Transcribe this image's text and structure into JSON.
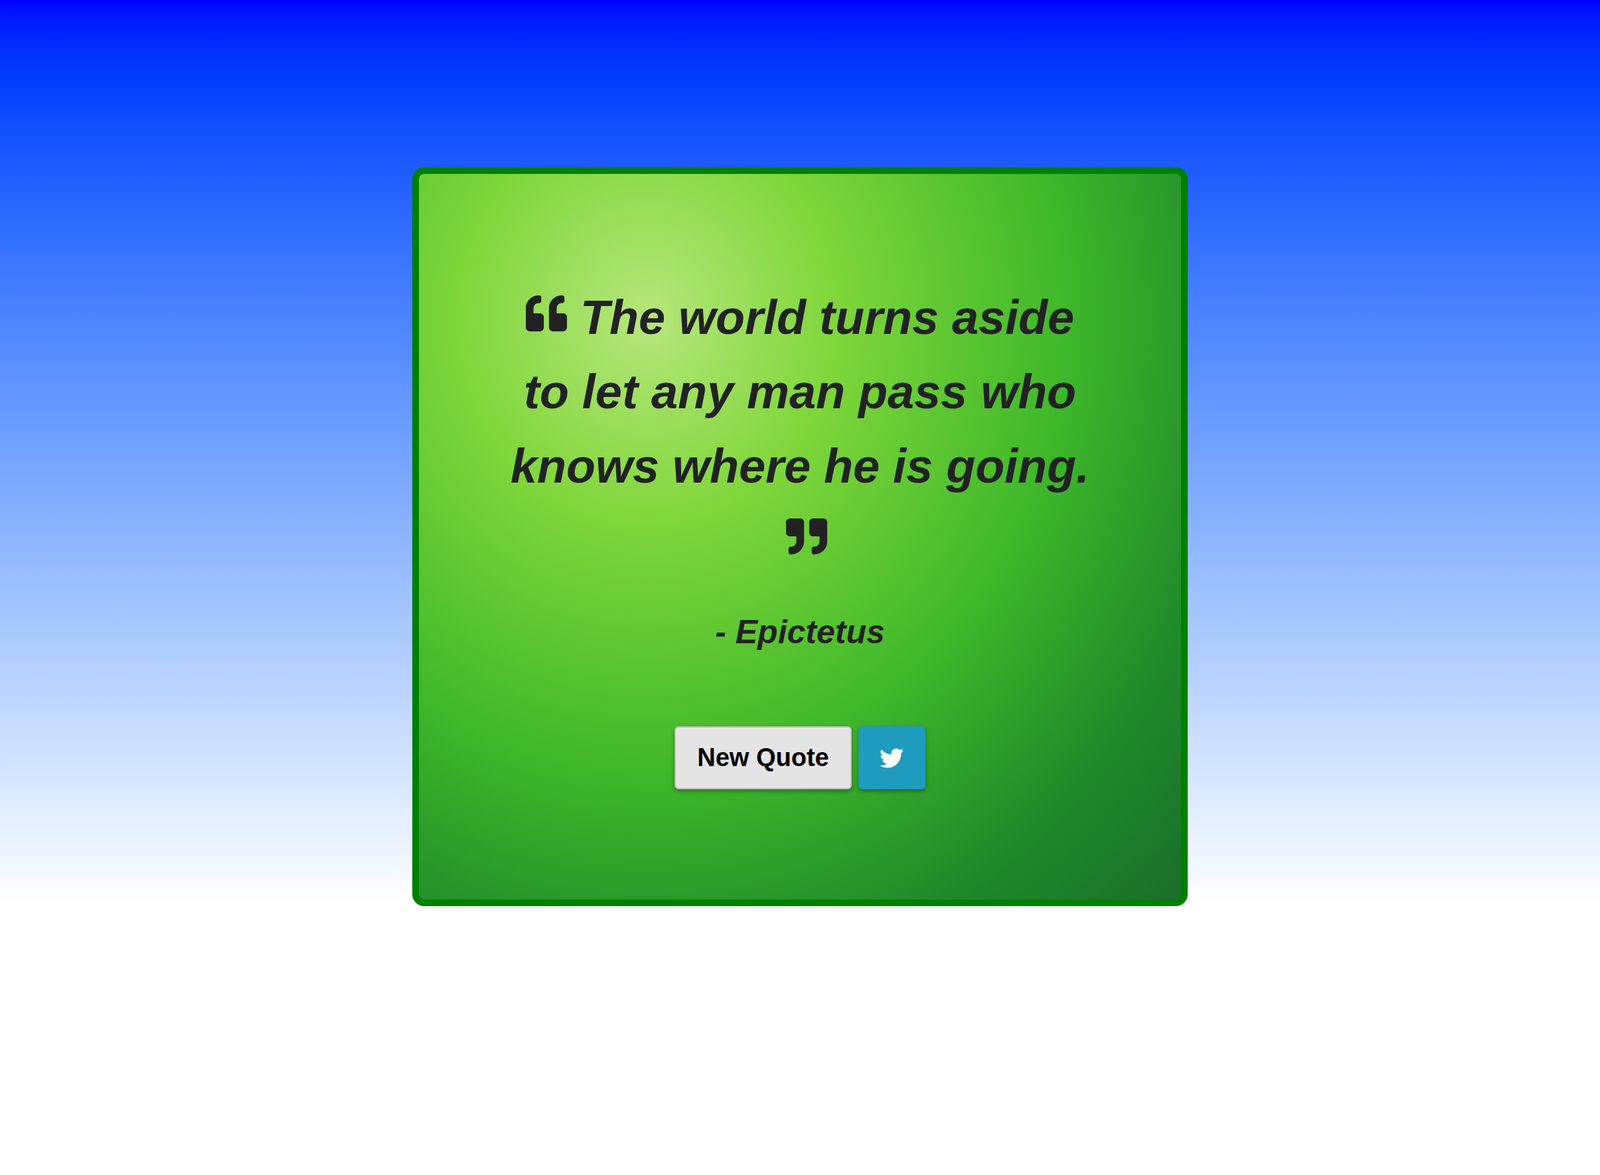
{
  "quote": {
    "text": "The world turns aside to let any man pass who knows where he is going.",
    "author": "- Epictetus"
  },
  "buttons": {
    "new_quote": "New Quote"
  }
}
